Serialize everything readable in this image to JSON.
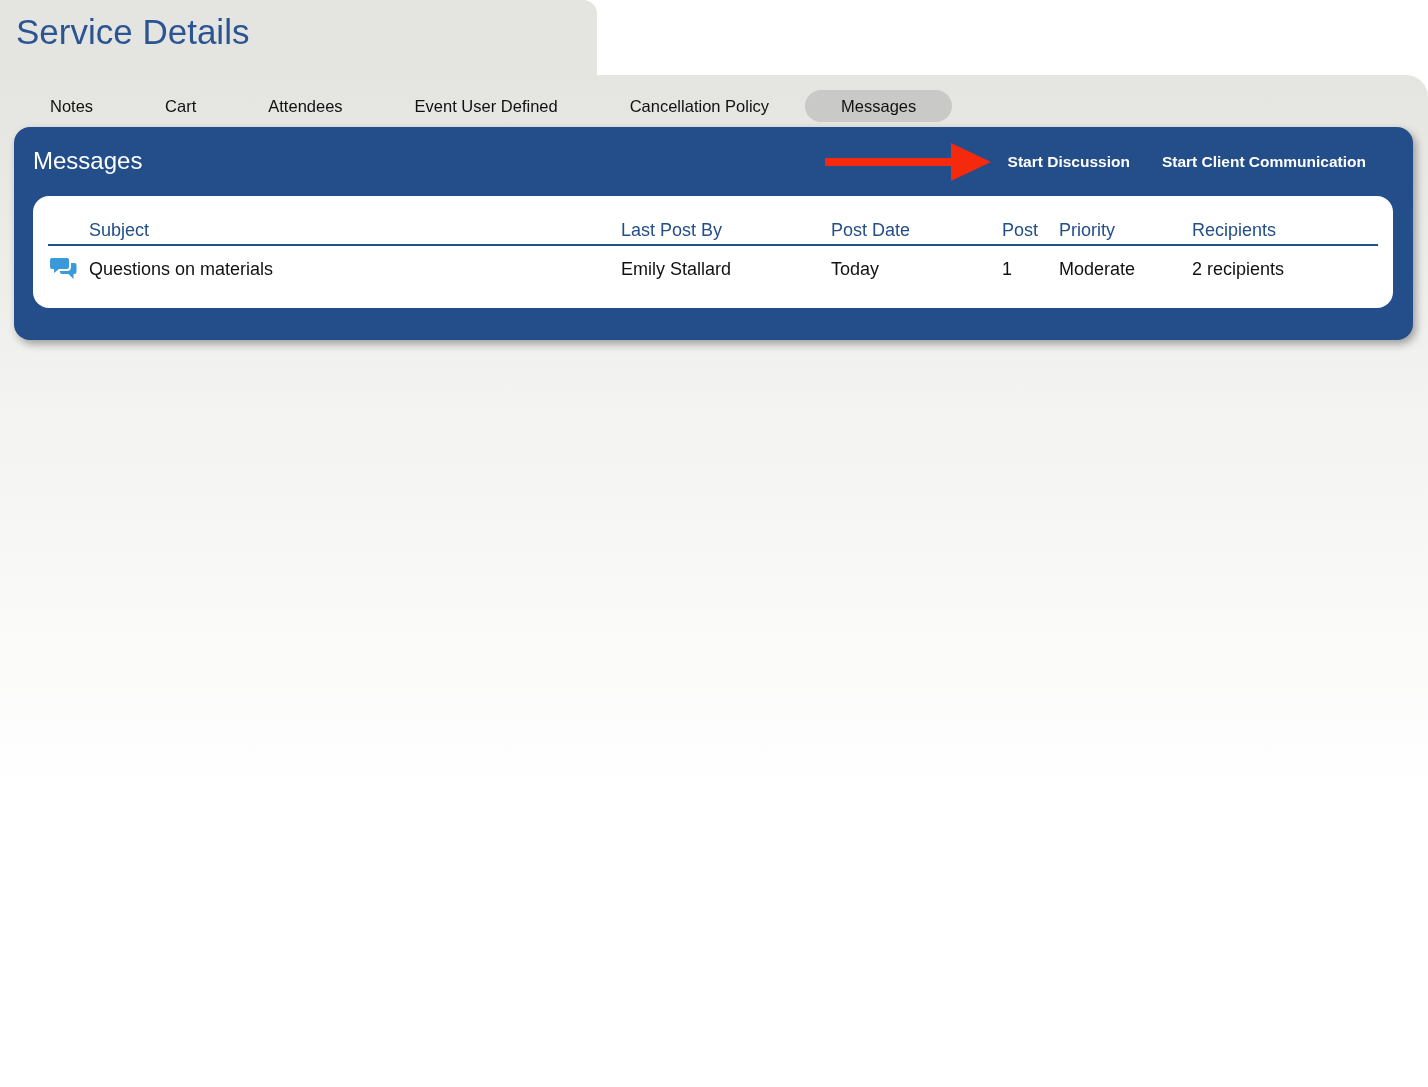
{
  "page": {
    "title": "Service Details"
  },
  "tabs": [
    {
      "label": "Notes",
      "selected": false
    },
    {
      "label": "Cart",
      "selected": false
    },
    {
      "label": "Attendees",
      "selected": false
    },
    {
      "label": "Event User Defined",
      "selected": false
    },
    {
      "label": "Cancellation Policy",
      "selected": false
    },
    {
      "label": "Messages",
      "selected": true
    }
  ],
  "panel": {
    "title": "Messages",
    "actions": [
      "Start Discussion",
      "Start Client Communication"
    ]
  },
  "table": {
    "columns": [
      "Subject",
      "Last Post By",
      "Post Date",
      "Post",
      "Priority",
      "Recipients"
    ],
    "rows": [
      {
        "subject": "Questions on materials",
        "last_post_by": "Emily Stallard",
        "post_date": "Today",
        "post": "1",
        "priority": "Moderate",
        "recipients": "2 recipients"
      }
    ]
  }
}
